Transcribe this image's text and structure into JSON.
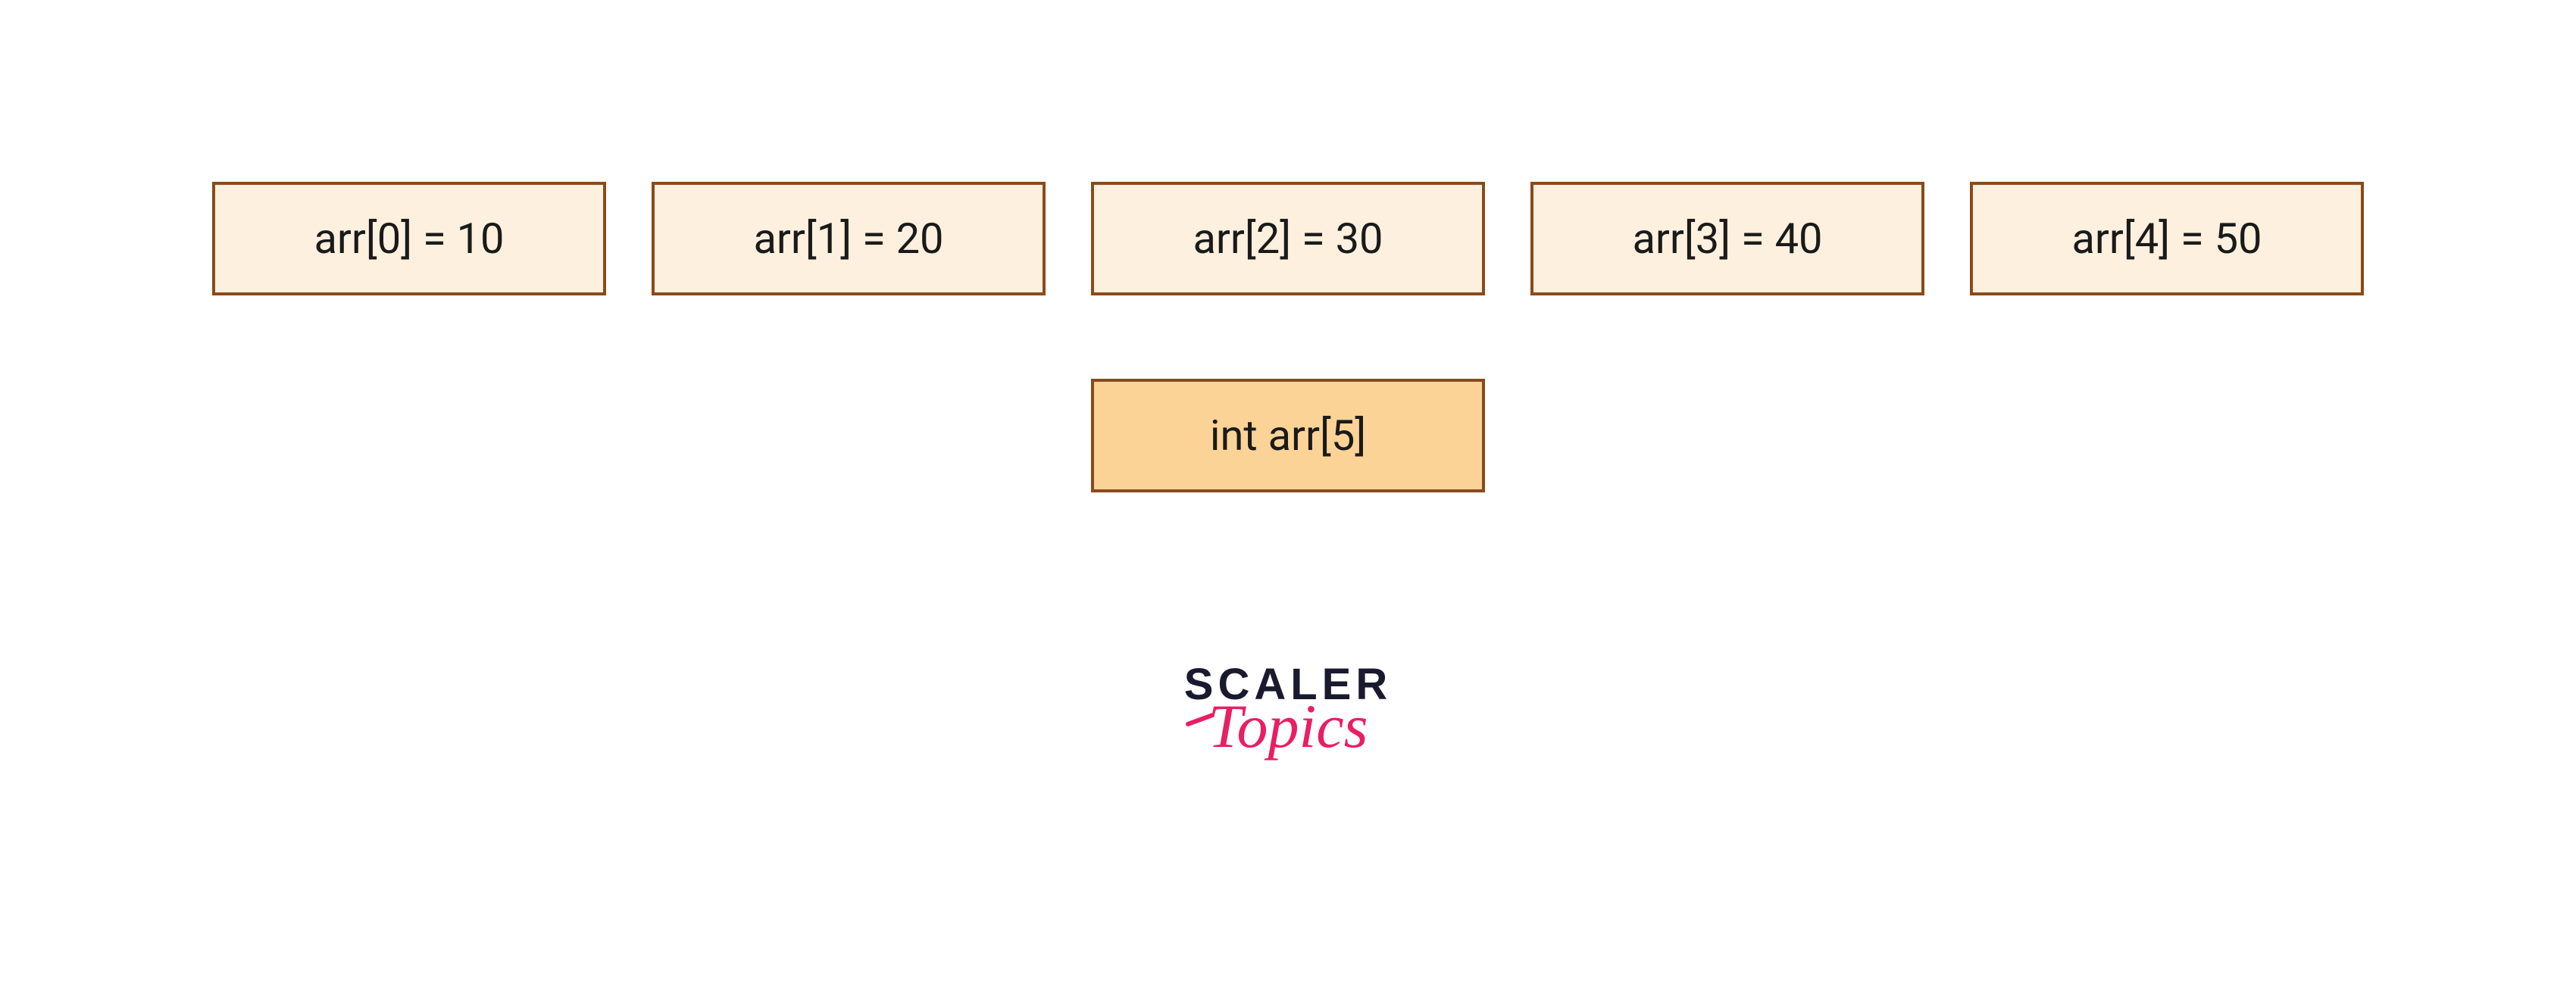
{
  "array_cells": [
    "arr[0] = 10",
    "arr[1] = 20",
    "arr[2] = 30",
    "arr[3] = 40",
    "arr[4] = 50"
  ],
  "declaration": "int arr[5]",
  "logo": {
    "line1": "SCALER",
    "line2": "Topics"
  },
  "colors": {
    "cell_bg": "#fdf0de",
    "cell_border": "#8b4a1a",
    "declaration_bg": "#fcd397",
    "logo_dark": "#1a1a2e",
    "logo_pink": "#e91e63"
  }
}
